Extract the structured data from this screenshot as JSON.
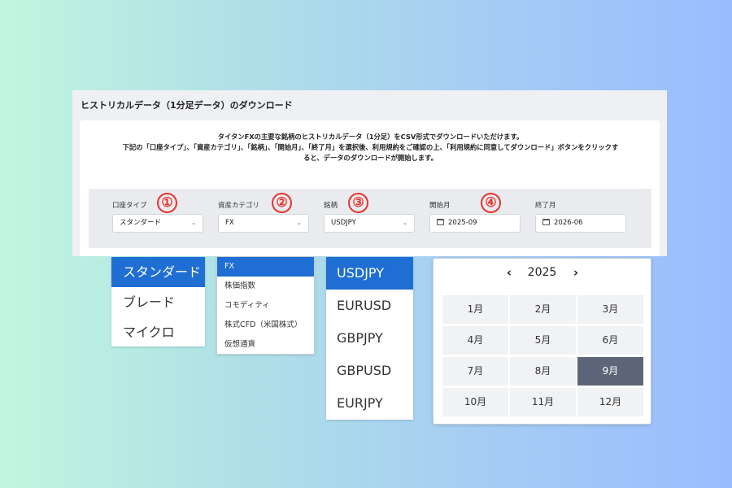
{
  "panel": {
    "title": "ヒストリカルデータ（1分足データ）のダウンロード",
    "intro_line1": "タイタンFXの主要な銘柄のヒストリカルデータ（1分足）をCSV形式でダウンロードいただけます。",
    "intro_line2": "下記の「口座タイプ」、「資産カテゴリ」、「銘柄」、「開始月」、「終了月」を選択後、利用規約をご確認の上、「利用規約に同意してダウンロード」ボタンをクリックす",
    "intro_line3": "ると、データのダウンロードが開始します。"
  },
  "filters": {
    "account_type": {
      "label": "口座タイプ",
      "value": "スタンダード",
      "icon": "chevron-down-icon"
    },
    "asset_category": {
      "label": "資産カテゴリ",
      "value": "FX",
      "icon": "chevron-down-icon"
    },
    "symbol": {
      "label": "銘柄",
      "value": "USDJPY",
      "icon": "chevron-down-icon"
    },
    "start_month": {
      "label": "開始月",
      "value": "2025-09",
      "icon": "calendar-icon"
    },
    "end_month": {
      "label": "終了月",
      "value": "2026-06",
      "icon": "calendar-icon"
    }
  },
  "badges": [
    "①",
    "②",
    "③",
    "④"
  ],
  "badge_color": "#e8342e",
  "accent_color": "#1f6ed4",
  "account_dropdown": {
    "options": [
      "スタンダード",
      "ブレード",
      "マイクロ"
    ],
    "selected": "スタンダード"
  },
  "category_dropdown": {
    "options": [
      "FX",
      "株価指数",
      "コモディティ",
      "株式CFD（米国株式）",
      "仮想通貨"
    ],
    "selected": "FX"
  },
  "symbol_dropdown": {
    "options": [
      "USDJPY",
      "EURUSD",
      "GBPJPY",
      "GBPUSD",
      "EURJPY"
    ],
    "selected": "USDJPY"
  },
  "month_picker": {
    "prev": "‹",
    "next": "›",
    "year": "2025",
    "months": [
      "1月",
      "2月",
      "3月",
      "4月",
      "5月",
      "6月",
      "7月",
      "8月",
      "9月",
      "10月",
      "11月",
      "12月"
    ],
    "selected": "9月",
    "selected_color": "#5d6678"
  }
}
